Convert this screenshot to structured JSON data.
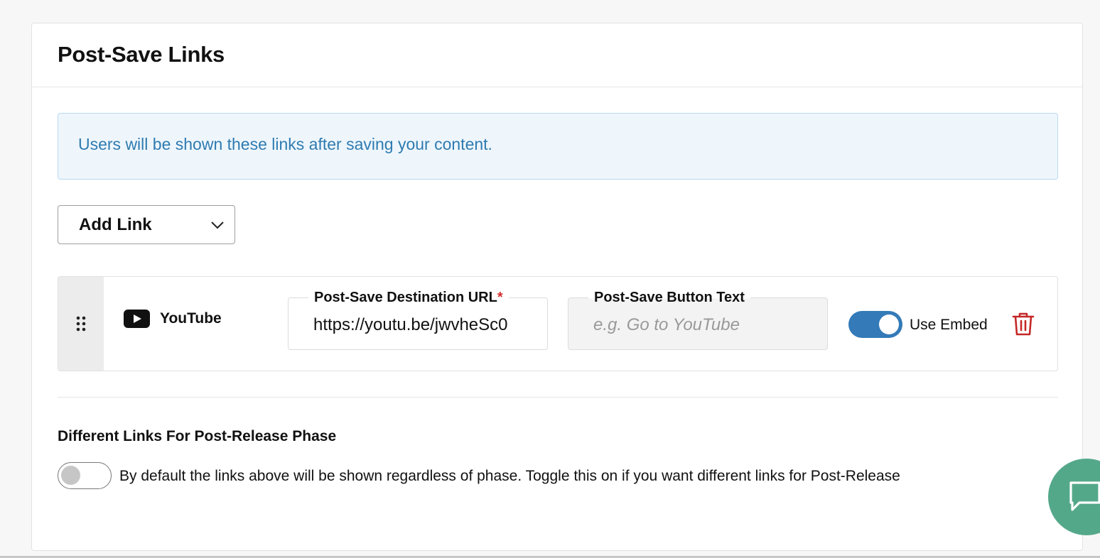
{
  "page": {
    "title": "Post-Save Links",
    "info_message": "Users will be shown these links after saving your content."
  },
  "add_link": {
    "label": "Add Link"
  },
  "links": [
    {
      "platform": "YouTube",
      "url_label": "Post-Save Destination URL",
      "url_required_mark": "*",
      "url_value": "https://youtu.be/jwvheSc0",
      "button_text_label": "Post-Save Button Text",
      "button_text_value": "",
      "button_text_placeholder": "e.g. Go to YouTube",
      "use_embed_label": "Use Embed",
      "use_embed": true
    }
  ],
  "post_release": {
    "title": "Different Links For Post-Release Phase",
    "toggle_on": false,
    "description": "By default the links above will be shown regardless of phase. Toggle this on if you want different links for Post-Release"
  },
  "colors": {
    "accent": "#347ab8",
    "info_text": "#2f7bb0",
    "info_bg": "#eef6fc",
    "danger": "#d32f2f",
    "chat_fab": "#54a88a"
  }
}
